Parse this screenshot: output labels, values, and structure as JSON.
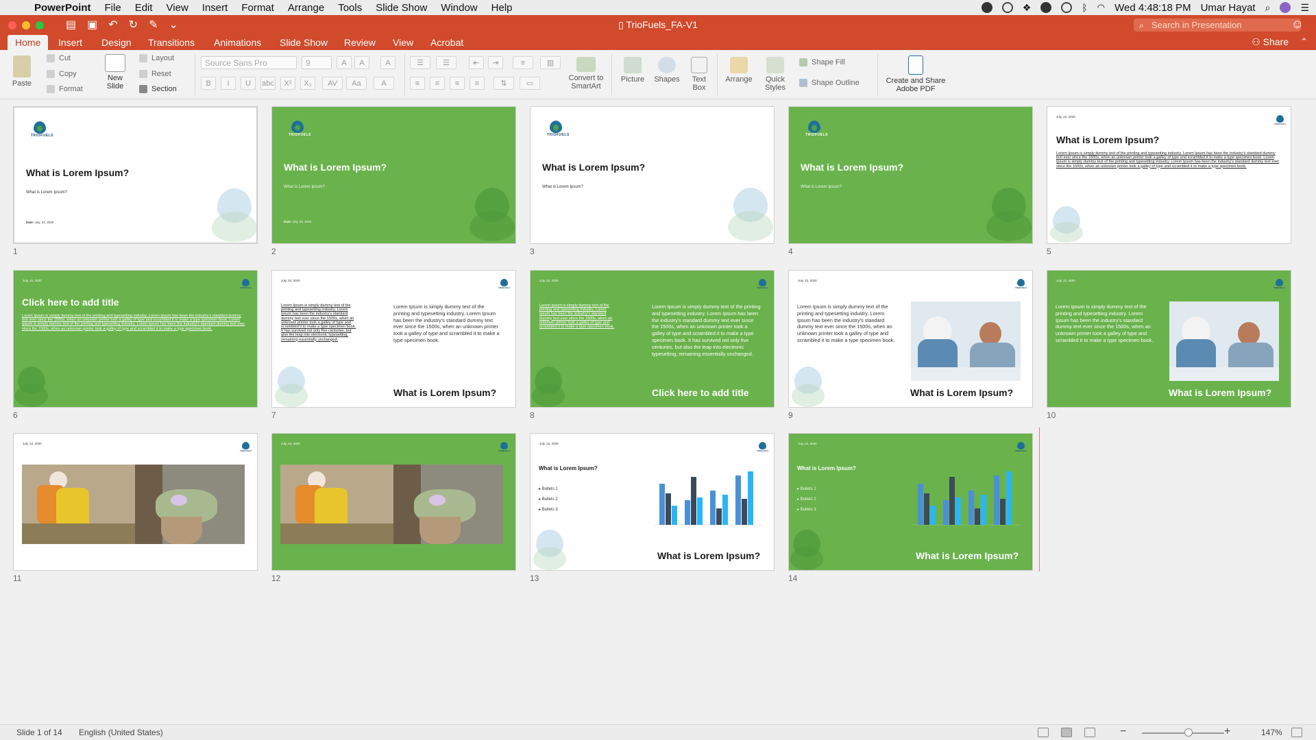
{
  "menubar": {
    "app_name": "PowerPoint",
    "items": [
      "File",
      "Edit",
      "View",
      "Insert",
      "Format",
      "Arrange",
      "Tools",
      "Slide Show",
      "Window",
      "Help"
    ],
    "clock": "Wed 4:48:18 PM",
    "user": "Umar Hayat"
  },
  "window": {
    "title": "TrioFuels_FA-V1",
    "search_placeholder": "Search in Presentation",
    "share_label": "Share"
  },
  "ribbon_tabs": [
    "Home",
    "Insert",
    "Design",
    "Transitions",
    "Animations",
    "Slide Show",
    "Review",
    "View",
    "Acrobat"
  ],
  "ribbon": {
    "paste": "Paste",
    "cut": "Cut",
    "copy": "Copy",
    "format": "Format",
    "new_slide": "New Slide",
    "layout": "Layout",
    "reset": "Reset",
    "section": "Section",
    "font_name": "Source Sans Pro",
    "font_size": "9",
    "convert_smartart": "Convert to SmartArt",
    "picture": "Picture",
    "shapes": "Shapes",
    "text_box": "Text Box",
    "arrange": "Arrange",
    "quick_styles": "Quick Styles",
    "shape_fill": "Shape Fill",
    "shape_outline": "Shape Outline",
    "adobe_pdf": "Create and Share Adobe PDF"
  },
  "slides": {
    "title": "What is Lorem Ipsum?",
    "subtitle": "What is Lorem Ipsum?",
    "date_label": "Date:",
    "date_value": "July, 22, 2020",
    "click_title": "Click here to add title",
    "body_short": "Lorem Ipsum is simply dummy text of the printing and typesetting industry. Lorem Ipsum has been the industry's standard dummy text ever since the 1500s, when an unknown printer took a galley of type and scrambled it to make a type specimen book.",
    "body_long": "Lorem Ipsum is simply dummy text of the printing and typesetting industry. Lorem Ipsum has been the industry's standard dummy text ever since the 1500s, when an unknown printer took a galley of type and scrambled it to make a type specimen book. It has survived not only five centuries, but also the leap into electronic typesetting, remaining essentially unchanged.",
    "underline_para": "Lorem Ipsum is simply dummy text of the printing and typesetting industry. Lorem Ipsum has been the industry's standard dummy text ever since the 1500s, when an unknown printer took a galley of type and scrambled it to make a type specimen book. Lorem Ipsum is simply dummy text of the printing and typesetting industry. Lorem Ipsum has been the industry's standard dummy text ever since the 1500s, when an unknown printer took a galley of type and scrambled it to make a type specimen book.",
    "bullets": [
      "Bullets 1",
      "Bullets 2",
      "Bullets 3"
    ],
    "numbers": [
      "1",
      "2",
      "3",
      "4",
      "5",
      "6",
      "7",
      "8",
      "9",
      "10",
      "11",
      "12",
      "13",
      "14"
    ]
  },
  "status": {
    "slide_info": "Slide 1 of 14",
    "language": "English (United States)",
    "zoom": "147%"
  },
  "colors": {
    "ribbon_red": "#d04a2b",
    "slide_green": "#6ab24c",
    "brand_blue": "#1f6f9a"
  }
}
